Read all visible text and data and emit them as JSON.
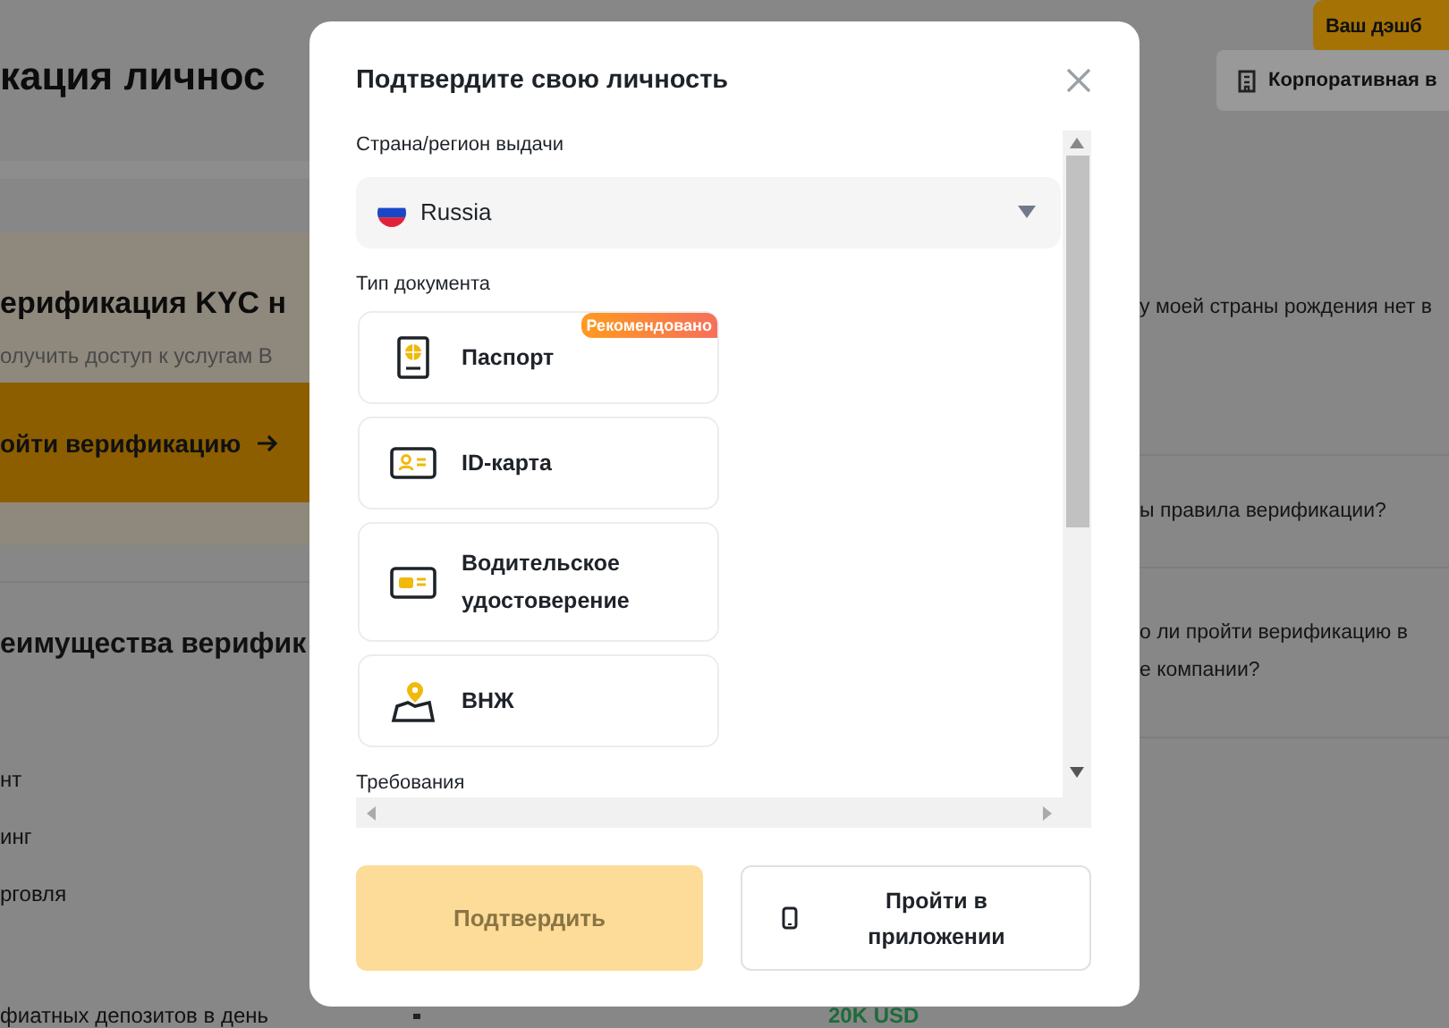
{
  "background": {
    "page_title": "кация личнос",
    "header_buttons": [
      {
        "label": "Ваш дэшб",
        "kind": "primary"
      },
      {
        "label": "Корпоративная в",
        "kind": "secondary"
      }
    ],
    "kyc_banner": {
      "title": "ерификация KYC н",
      "subtitle": "олучить доступ к услугам В",
      "button": "ойти верификацию"
    },
    "benefits_title": "еимущества верифик",
    "benefit_rows": [
      "нт",
      "инг",
      "рговля"
    ],
    "limit_row": {
      "label": "фиатных депозитов в день",
      "value": "20K USD"
    },
    "faq": [
      [
        "у моей страны рождения нет в"
      ],
      [
        "ы правила верификации?"
      ],
      [
        "о ли пройти верификацию в",
        "е компании?"
      ]
    ]
  },
  "dialog": {
    "title": "Подтвердите свою личность",
    "country_label": "Страна/регион выдачи",
    "country": {
      "value": "Russia"
    },
    "document_label": "Тип документа",
    "documents": [
      {
        "label": "Паспорт",
        "kind": "passport",
        "badge": "Рекомендовано"
      },
      {
        "label": "ID-карта",
        "kind": "id_card"
      },
      {
        "label": "Водительское удостоверение",
        "kind": "license"
      },
      {
        "label": "ВНЖ",
        "kind": "residence"
      }
    ],
    "requirements_label": "Требования",
    "confirm_button": {
      "label": "Подтвердить",
      "disabled": true
    },
    "app_button": {
      "label": "Пройти в приложении"
    }
  }
}
